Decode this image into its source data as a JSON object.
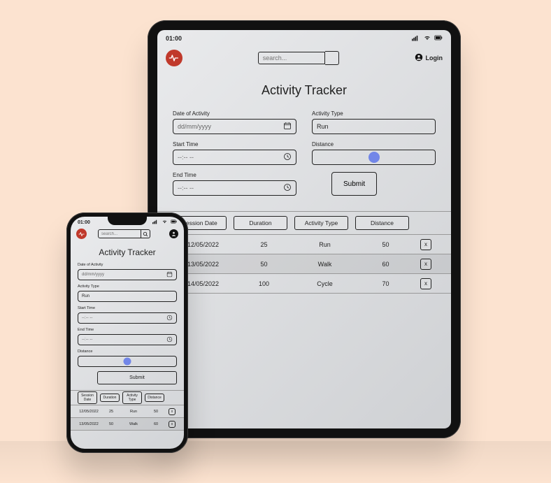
{
  "status": {
    "time": "01:00"
  },
  "header": {
    "search_placeholder": "search...",
    "login_label": "Login"
  },
  "page_title": "Activity Tracker",
  "form": {
    "date_label": "Date of Activity",
    "date_value": "dd/mm/yyyy",
    "type_label": "Activity Type",
    "type_value": "Run",
    "start_label": "Start Time",
    "start_value": "--:-- --",
    "end_label": "End Time",
    "end_value": "--:-- --",
    "distance_label": "Distance",
    "submit_label": "Submit"
  },
  "table": {
    "headers": {
      "date": "Session Date",
      "duration": "Duration",
      "type": "Activity Type",
      "distance": "Distance"
    },
    "rows": [
      {
        "date": "12/05/2022",
        "duration": "25",
        "type": "Run",
        "distance": "50"
      },
      {
        "date": "13/05/2022",
        "duration": "50",
        "type": "Walk",
        "distance": "60"
      },
      {
        "date": "14/05/2022",
        "duration": "100",
        "type": "Cycle",
        "distance": "70"
      }
    ],
    "delete_label": "x"
  },
  "phone_table": {
    "rows": [
      {
        "date": "12/05/2022",
        "duration": "25",
        "type": "Run",
        "distance": "50"
      },
      {
        "date": "13/05/2022",
        "duration": "50",
        "type": "Walk",
        "distance": "60"
      }
    ]
  }
}
